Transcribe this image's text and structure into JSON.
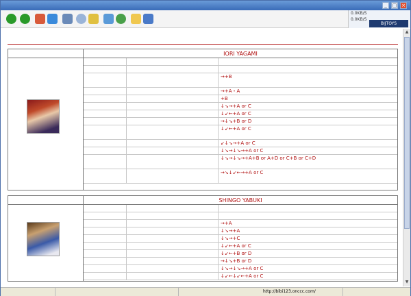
{
  "title_bar": {
    "title": "",
    "btn_min": "_",
    "btn_max": "□",
    "btn_close": "×"
  },
  "net_speed": {
    "down": "0.0KB/S",
    "up": "0.0KB/S",
    "logo": "BIJTOYS"
  },
  "content": {
    "heading": "",
    "chars": [
      {
        "name_cn": "",
        "name_en": "IORI YAGAMI",
        "rows": [
          {
            "cat": "",
            "move": "",
            "cmd": "",
            "tall": false
          },
          {
            "cat": "",
            "move": "",
            "cmd": "",
            "tall": false
          },
          {
            "cat": "",
            "move": "",
            "cmd": "→+B",
            "tall": true
          },
          {
            "cat": "",
            "move": "",
            "cmd": "→+A・A",
            "tall": false
          },
          {
            "cat": "",
            "move": "",
            "cmd": "+B",
            "tall": false
          },
          {
            "cat": "",
            "move": "",
            "cmd": "↓↘→+A or C",
            "tall": false
          },
          {
            "cat": "",
            "move": "",
            "cmd": "↓↙←+A or C",
            "tall": false
          },
          {
            "cat": "",
            "move": "",
            "cmd": "→↓↘+B or D",
            "tall": false
          },
          {
            "cat": "",
            "move": "",
            "cmd": "↓↙←+A or C",
            "tall": true
          },
          {
            "cat": "",
            "move": "",
            "cmd": "↙↓↘→+A or C",
            "tall": false
          },
          {
            "cat": "",
            "move": "",
            "cmd": "↓↘→↓↘→+A or C",
            "tall": false
          },
          {
            "cat": "",
            "move": "",
            "cmd": "↓↘→↓↘→+A+B or A+D or C+B or C+D",
            "tall": true
          },
          {
            "cat": "",
            "move": "",
            "cmd": "→↘↓↙←→+A or C",
            "tall": true
          }
        ]
      },
      {
        "name_cn": "",
        "name_en": "SHINGO YABUKI",
        "rows": [
          {
            "cat": "",
            "move": "",
            "cmd": "",
            "tall": false
          },
          {
            "cat": "",
            "move": "",
            "cmd": "",
            "tall": false
          },
          {
            "cat": "",
            "move": "",
            "cmd": "→+A",
            "tall": false
          },
          {
            "cat": "",
            "move": "",
            "cmd": "↓↘→+A",
            "tall": false
          },
          {
            "cat": "",
            "move": "",
            "cmd": "↓↘→+C",
            "tall": false
          },
          {
            "cat": "",
            "move": "",
            "cmd": "↓↙←+A or C",
            "tall": false
          },
          {
            "cat": "",
            "move": "",
            "cmd": "↓↙←+B or D",
            "tall": false
          },
          {
            "cat": "",
            "move": "",
            "cmd": "→↓↘+B or D",
            "tall": false
          },
          {
            "cat": "",
            "move": "",
            "cmd": "↓↘→↓↘→+A or C",
            "tall": false
          },
          {
            "cat": "",
            "move": "",
            "cmd": "↓↙←↓↙←+A or C",
            "tall": false
          }
        ]
      }
    ]
  },
  "status_bar": {
    "left": "",
    "author": "",
    "company": "",
    "url": "http://bibi123.onccc.com/"
  }
}
